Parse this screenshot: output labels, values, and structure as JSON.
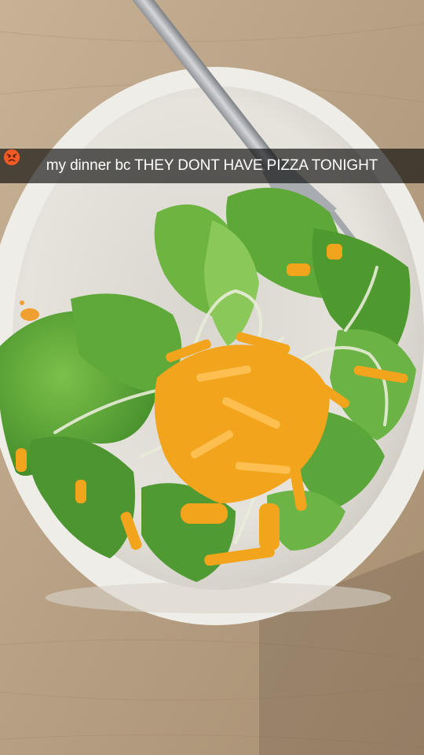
{
  "story": {
    "caption": "my dinner bc THEY DONT HAVE PIZZA TONIGHT",
    "caption_emoji": "angry-face-emoji"
  },
  "colors": {
    "table": "#b9a48a",
    "bowl": "#eceae4",
    "lettuce": "#4f9a32",
    "cheese": "#f2a41c",
    "caption_bar": "rgba(0,0,0,0.62)"
  }
}
